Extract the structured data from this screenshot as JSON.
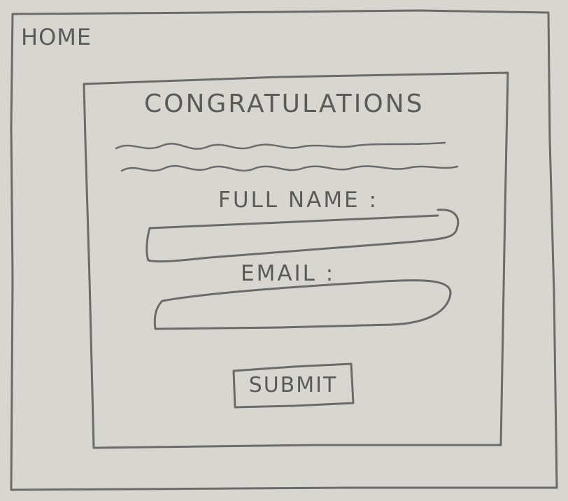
{
  "nav": {
    "home_label": "HOME"
  },
  "dialog": {
    "title": "CONGRATULATIONS",
    "full_name_label": "FULL NAME :",
    "full_name_value": "",
    "email_label": "EMAIL :",
    "email_value": "",
    "submit_label": "SUBMIT"
  },
  "colors": {
    "paper": "#d9d6d0",
    "pencil": "#6b6b69"
  }
}
